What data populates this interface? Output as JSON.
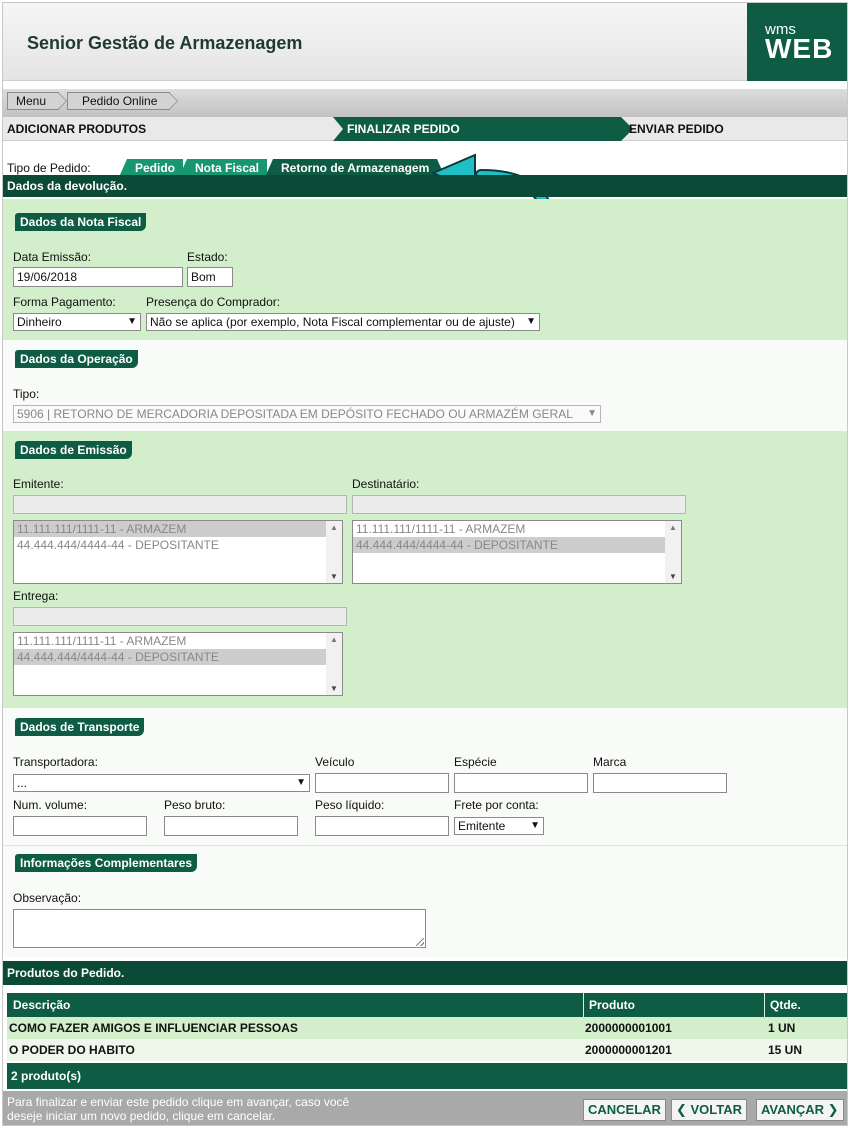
{
  "header": {
    "app_title": "Senior Gestão de Armazenagem",
    "logo_small": "wms",
    "logo_big": "WEB"
  },
  "breadcrumb": {
    "items": [
      "Menu",
      "Pedido Online"
    ]
  },
  "steps": [
    "ADICIONAR PRODUTOS",
    "FINALIZAR PEDIDO",
    "ENVIAR PEDIDO"
  ],
  "tipo_pedido": {
    "label": "Tipo de Pedido:",
    "tabs": [
      "Pedido",
      "Nota Fiscal",
      "Retorno de Armazenagem"
    ],
    "active": "Retorno de Armazenagem"
  },
  "section_title": "Dados da devolução.",
  "nota_fiscal": {
    "legend": "Dados da Nota Fiscal",
    "data_emissao_label": "Data Emissão:",
    "data_emissao_value": "19/06/2018",
    "estado_label": "Estado:",
    "estado_value": "Bom",
    "forma_pagamento_label": "Forma Pagamento:",
    "forma_pagamento_value": "Dinheiro",
    "presenca_label": "Presença do Comprador:",
    "presenca_value": "Não se aplica (por exemplo, Nota Fiscal complementar ou de ajuste)"
  },
  "operacao": {
    "legend": "Dados da Operação",
    "tipo_label": "Tipo:",
    "tipo_value": "5906 | RETORNO DE MERCADORIA DEPOSITADA EM DEPÓSITO FECHADO OU ARMAZÉM GERAL"
  },
  "emissao": {
    "legend": "Dados de Emissão",
    "emitente_label": "Emitente:",
    "emitente_options": [
      "11.111.111/1111-11 - ARMAZEM",
      "44.444.444/4444-44 - DEPOSITANTE"
    ],
    "destinatario_label": "Destinatário:",
    "destinatario_options": [
      "11.111.111/1111-11 - ARMAZEM",
      "44.444.444/4444-44 - DEPOSITANTE"
    ],
    "entrega_label": "Entrega:",
    "entrega_options": [
      "11.111.111/1111-11 - ARMAZEM",
      "44.444.444/4444-44 - DEPOSITANTE"
    ]
  },
  "transporte": {
    "legend": "Dados de Transporte",
    "transportadora_label": "Transportadora:",
    "transportadora_value": "...",
    "veiculo_label": "Veículo",
    "especie_label": "Espécie",
    "marca_label": "Marca",
    "num_volume_label": "Num. volume:",
    "peso_bruto_label": "Peso bruto:",
    "peso_liquido_label": "Peso líquido:",
    "frete_label": "Frete por conta:",
    "frete_value": "Emitente"
  },
  "complementares": {
    "legend": "Informações Complementares",
    "observacao_label": "Observação:"
  },
  "produtos": {
    "title": "Produtos do Pedido.",
    "columns": [
      "Descrição",
      "Produto",
      "Qtde."
    ],
    "rows": [
      [
        "COMO FAZER AMIGOS E INFLUENCIAR PESSOAS",
        "2000000001001",
        "1 UN"
      ],
      [
        "O PODER DO HABITO",
        "2000000001201",
        "15 UN"
      ]
    ],
    "count": "2 produto(s)"
  },
  "footer": {
    "help": "Para finalizar e enviar este pedido clique em avançar, caso você deseje iniciar um novo pedido, clique em cancelar.",
    "cancel": "CANCELAR",
    "back": "❮ VOLTAR",
    "next": "AVANÇAR ❯"
  },
  "colors": {
    "brand": "#0f5c45",
    "panel_green": "#d2eecb",
    "accent_arrow": "#1fbfc4"
  }
}
